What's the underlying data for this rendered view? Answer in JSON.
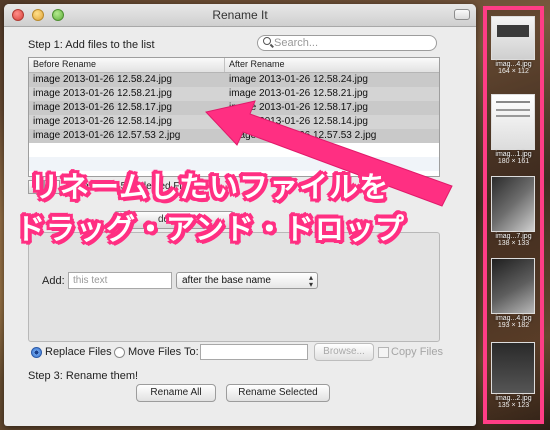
{
  "window": {
    "title": "Rename It"
  },
  "step1": {
    "label": "Step 1: Add files to the list"
  },
  "search": {
    "placeholder": "Search..."
  },
  "table": {
    "headers": [
      "Before Rename",
      "After Rename"
    ],
    "rows": [
      [
        "image 2013-01-26 12.58.24.jpg",
        "image 2013-01-26 12.58.24.jpg"
      ],
      [
        "image 2013-01-26 12.58.21.jpg",
        "image 2013-01-26 12.58.21.jpg"
      ],
      [
        "image 2013-01-26 12.58.17.jpg",
        "image 2013-01-26 12.58.17.jpg"
      ],
      [
        "image 2013-01-26 12.58.14.jpg",
        "image 2013-01-26 12.58.14.jpg"
      ],
      [
        "image 2013-01-26 12.57.53 2.jpg",
        "image 2013-01-26 12.57.53 2.jpg"
      ]
    ]
  },
  "list_controls": {
    "add": "+",
    "remove": "−",
    "totals": "Total Files: 5,  Selected Files: 5"
  },
  "options": {
    "tab_label": "dd Text",
    "add_label": "Add:",
    "add_placeholder": "this text",
    "position_select": "after the base name"
  },
  "file_mode": {
    "replace_label": "Replace Files",
    "move_label": "Move Files To:",
    "browse_label": "Browse...",
    "copy_label": "Copy Files"
  },
  "step3": {
    "label": "Step 3: Rename them!",
    "rename_all": "Rename All",
    "rename_selected": "Rename Selected"
  },
  "annotation": {
    "line1": "リネームしたいファイルを",
    "line2": "ドラッグ・アンド・ドロップ",
    "color": "#ff2f82"
  },
  "thumbnails": [
    {
      "name": "imag...4.jpg",
      "dims": "164 × 112"
    },
    {
      "name": "imag...1.jpg",
      "dims": "180 × 161"
    },
    {
      "name": "imag...7.jpg",
      "dims": "138 × 133"
    },
    {
      "name": "imag...4.jpg",
      "dims": "193 × 182"
    },
    {
      "name": "imag...2.jpg",
      "dims": "135 × 123"
    }
  ]
}
